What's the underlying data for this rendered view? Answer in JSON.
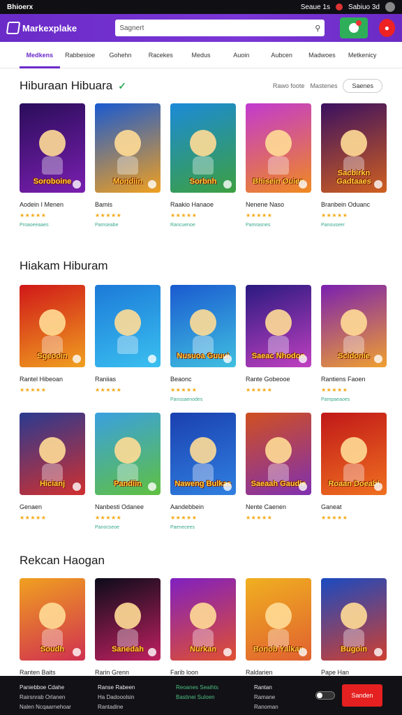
{
  "statusbar": {
    "left": "Bhioerx",
    "time": "Seaue 1s",
    "right": "Sabiuo 3d"
  },
  "topbar": {
    "brand": "Markexplake",
    "search_placeholder": "Sagnert"
  },
  "nav": [
    "Medkens",
    "Rabbesioe",
    "Gohehn",
    "Racekes",
    "Medus",
    "Auoin",
    "Aubcen",
    "Madwoes",
    "Metkenicy"
  ],
  "section1": {
    "title": "Hiburaan Hibuara",
    "links": [
      "Rawo foote",
      "Mastenes"
    ],
    "more": "Saenes",
    "cards": [
      {
        "name": "Aodein I Menen",
        "thumb_title": "Soroboine",
        "colors": [
          "#2a0d5a",
          "#7a1fb0"
        ],
        "tag": "Proaoeeaaes"
      },
      {
        "name": "Bamis",
        "thumb_title": "Mondiin",
        "colors": [
          "#1a5ad0",
          "#f0a020"
        ],
        "tag": "Pamseabe"
      },
      {
        "name": "Raakio Hanaoe",
        "thumb_title": "Sorbnh",
        "colors": [
          "#1c8ad8",
          "#3ca040"
        ],
        "tag": "Rancuenoe"
      },
      {
        "name": "Nenene Naso",
        "thumb_title": "Bhisein Ouien",
        "colors": [
          "#c23ad0",
          "#f08a20"
        ],
        "tag": "Pamrasnes"
      },
      {
        "name": "Branbein Oduanc",
        "thumb_title": "Sacbirkn Gadtaaes",
        "colors": [
          "#3a1060",
          "#d06020"
        ],
        "tag": "Panouseer"
      }
    ]
  },
  "section2": {
    "title": "Hiakam Hiburam",
    "row1": [
      {
        "name": "Rantel Hibeoan",
        "thumb_title": "Sgeooin",
        "colors": [
          "#d01818",
          "#f0a020"
        ],
        "tag": ""
      },
      {
        "name": "Raniias",
        "thumb_title": "",
        "colors": [
          "#1c7ad8",
          "#3ac0f0"
        ],
        "tag": ""
      },
      {
        "name": "Beaonc",
        "thumb_title": "Nusuoa Guuui",
        "colors": [
          "#1a5ad0",
          "#40c0e0"
        ],
        "tag": "Panssaenodes"
      },
      {
        "name": "Rante Gobeooe",
        "thumb_title": "Saeac Nhodon",
        "colors": [
          "#2a1a80",
          "#c040c0"
        ],
        "tag": ""
      },
      {
        "name": "Rantiens Faoen",
        "thumb_title": "Scidonie",
        "colors": [
          "#7a20b0",
          "#f0a030"
        ],
        "tag": "Pampaeaoes"
      }
    ],
    "row2": [
      {
        "name": "Genaen",
        "thumb_title": "Hicianj",
        "colors": [
          "#2a3a90",
          "#d03030"
        ],
        "tag": ""
      },
      {
        "name": "Nanbesti Odanee",
        "thumb_title": "Pandiin",
        "colors": [
          "#3aa0e0",
          "#60c040"
        ],
        "tag": "Panocseoe"
      },
      {
        "name": "Aandebbein",
        "thumb_title": "Naweng Bulkas",
        "colors": [
          "#1a40b0",
          "#3080e0"
        ],
        "tag": "Paenecees"
      },
      {
        "name": "Nente Caenen",
        "thumb_title": "Saeaah Gaudie",
        "colors": [
          "#d05020",
          "#8030b0"
        ],
        "tag": ""
      },
      {
        "name": "Ganeat",
        "thumb_title": "Roaan Doeabl",
        "colors": [
          "#c01818",
          "#f07020"
        ],
        "tag": ""
      }
    ]
  },
  "section3": {
    "title": "Rekcan Haogan",
    "cards": [
      {
        "name": "Ranten Baits",
        "thumb_title": "Soudh",
        "colors": [
          "#f0a020",
          "#d03050"
        ]
      },
      {
        "name": "Rarin Grenn",
        "thumb_title": "Sanedah",
        "colors": [
          "#0c0c1a",
          "#c02060"
        ]
      },
      {
        "name": "Farib loon",
        "thumb_title": "Nurkan",
        "colors": [
          "#8020c0",
          "#e05030"
        ]
      },
      {
        "name": "Raldarien",
        "thumb_title": "Bonob Yalkan",
        "colors": [
          "#f0b020",
          "#e06030"
        ]
      },
      {
        "name": "Pape Han",
        "thumb_title": "Bugoin",
        "colors": [
          "#1a4ac0",
          "#d04030"
        ]
      }
    ]
  },
  "footer": {
    "cols": [
      [
        "Paniebboe Cdahe",
        "Rairsnrab Orlanen",
        "Nalen Ncqaarnehoar"
      ],
      [
        "Ranse Rabeen",
        "Ha Dadooolsin",
        "Rantadine"
      ],
      [
        "Reoanes Seaihts",
        "Bastinei Suloen"
      ],
      [
        "Rantan",
        "Ramane",
        "Ranoman"
      ]
    ],
    "cta": "Sanden"
  }
}
